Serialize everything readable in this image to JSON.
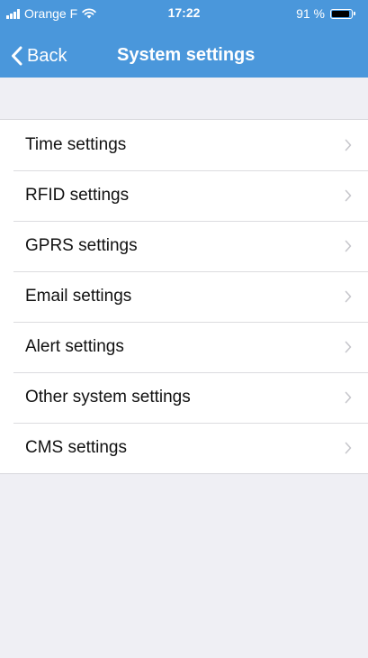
{
  "status_bar": {
    "carrier": "Orange F",
    "time": "17:22",
    "battery_pct": "91 %",
    "battery_level": 0.91
  },
  "nav": {
    "back_label": "Back",
    "title": "System settings"
  },
  "settings": {
    "items": [
      {
        "label": "Time settings"
      },
      {
        "label": "RFID settings"
      },
      {
        "label": "GPRS settings"
      },
      {
        "label": "Email settings"
      },
      {
        "label": "Alert settings"
      },
      {
        "label": "Other system settings"
      },
      {
        "label": "CMS settings"
      }
    ]
  },
  "colors": {
    "nav_background": "#4a97db",
    "page_background": "#efeff4",
    "chevron": "#c7c7cc"
  }
}
